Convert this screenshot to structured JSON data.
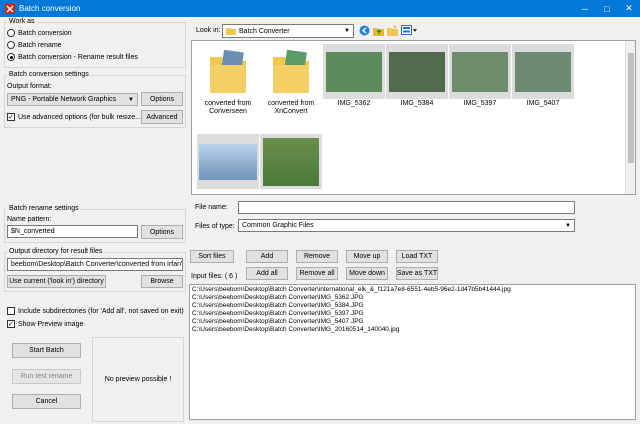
{
  "window": {
    "title": "Batch conversion",
    "min": "─",
    "max": "□",
    "close": "✕"
  },
  "work_as": {
    "label": "Work as",
    "options": [
      "Batch conversion",
      "Batch rename",
      "Batch conversion - Rename result files"
    ],
    "selected": 2
  },
  "conversion_settings": {
    "label": "Batch conversion settings",
    "output_format_label": "Output format:",
    "output_format_value": "PNG - Portable Network Graphics",
    "options_button": "Options",
    "advanced_checkbox": "Use advanced options (for bulk resize...)",
    "advanced_checked": true,
    "advanced_button": "Advanced"
  },
  "rename_settings": {
    "label": "Batch rename settings",
    "name_pattern_label": "Name pattern:",
    "name_pattern_value": "$N_converted",
    "options_button": "Options"
  },
  "output_dir": {
    "label": "Output directory for result files",
    "value": "beebom\\Desktop\\Batch Converter\\converted from IrfanView",
    "use_current_button": "Use current ('look in') directory",
    "browse_button": "Browse"
  },
  "checks": {
    "include_subdirs": "Include subdirectories (for 'Add all', not saved on exit)",
    "include_subdirs_checked": false,
    "show_preview": "Show Preview image",
    "show_preview_checked": true
  },
  "actions": {
    "start": "Start Batch",
    "test_rename": "Run test rename",
    "cancel": "Cancel"
  },
  "preview": {
    "text": "No preview possible !"
  },
  "lookin": {
    "label": "Look in:",
    "value": "Batch Converter"
  },
  "files": [
    {
      "name": "converted from Converseen",
      "kind": "folder"
    },
    {
      "name": "converted from XnConvert",
      "kind": "folder"
    },
    {
      "name": "IMG_5362",
      "kind": "image",
      "color": "#5d8a5a"
    },
    {
      "name": "IMG_5384",
      "kind": "image",
      "color": "#4f6a4c"
    },
    {
      "name": "IMG_5397",
      "kind": "image",
      "color": "#6e8d6a"
    },
    {
      "name": "IMG_5407",
      "kind": "image",
      "color": "#6c8a72"
    },
    {
      "name": "",
      "kind": "image",
      "color": "#6f93b8"
    },
    {
      "name": "",
      "kind": "image",
      "color": "#4a7a3b"
    }
  ],
  "file_name": {
    "label": "File name:",
    "value": ""
  },
  "file_type": {
    "label": "Files of type:",
    "value": "Common Graphic Files"
  },
  "list_buttons": {
    "sort": "Sort files",
    "add": "Add",
    "remove": "Remove",
    "move_up": "Move up",
    "load_txt": "Load TXT",
    "add_all": "Add all",
    "remove_all": "Remove all",
    "move_down": "Move down",
    "save_txt": "Save as TXT"
  },
  "input_files": {
    "label": "Input files: ( 6 )",
    "items": [
      "C:\\Users\\beebom\\Desktop\\Batch Converter\\international_elk_&_f121a7e8-6551-4eb5-96e2-1d47b5b41444.jpg",
      "C:\\Users\\beebom\\Desktop\\Batch Converter\\IMG_5362.JPG",
      "C:\\Users\\beebom\\Desktop\\Batch Converter\\IMG_5384.JPG",
      "C:\\Users\\beebom\\Desktop\\Batch Converter\\IMG_5397.JPG",
      "C:\\Users\\beebom\\Desktop\\Batch Converter\\IMG_5407.JPG",
      "C:\\Users\\beebom\\Desktop\\Batch Converter\\IMG_20160514_140040.jpg"
    ]
  },
  "colors": {
    "titlebar": "#0078d7",
    "folder": "#f0c64e"
  }
}
